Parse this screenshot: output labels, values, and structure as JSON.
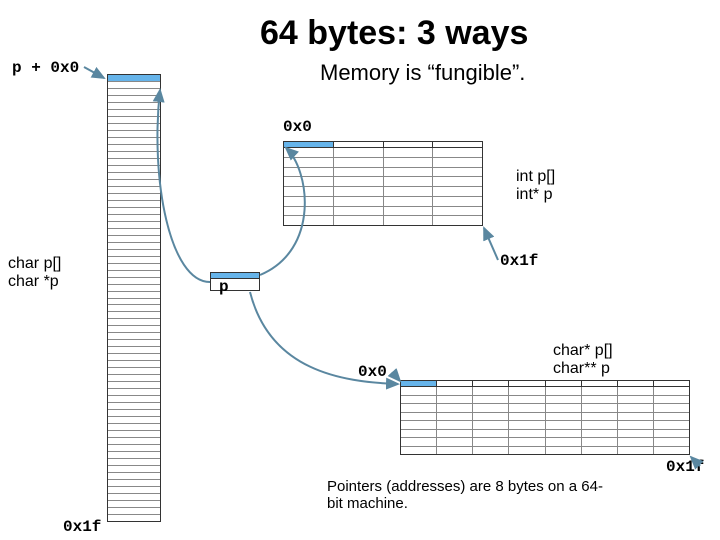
{
  "title": "64 bytes: 3 ways",
  "subtitle": "Memory is “fungible”.",
  "pointer_note": "Pointers (addresses) are 8 bytes on a 64-bit machine.",
  "views": {
    "char": {
      "decl1": "char p[]",
      "decl2": "char *p",
      "expr_top": "p + 0x0",
      "addr_bottom": "0x1f",
      "rows": 64,
      "highlight_row": 0,
      "highlight_color": "#66b4ea"
    },
    "int": {
      "decl1": "int p[]",
      "decl2": "int* p",
      "addr_top": "0x0",
      "addr_bottom": "0x1f",
      "rows": 8,
      "cols": 4,
      "header_cells": 4,
      "header_hl_col": 0,
      "highlight_color": "#66b4ea"
    },
    "charptr": {
      "decl1": "char* p[]",
      "decl2": "char** p",
      "addr_top": "0x0",
      "addr_bottom": "0x1f",
      "rows": 8,
      "cols": 8,
      "header_cells": 8,
      "header_hl_col": 0,
      "highlight_color": "#66b4ea"
    },
    "pointer_box": {
      "label": "p"
    }
  },
  "colors": {
    "accent": "#66b4ea",
    "arrow": "#5a87a0"
  }
}
